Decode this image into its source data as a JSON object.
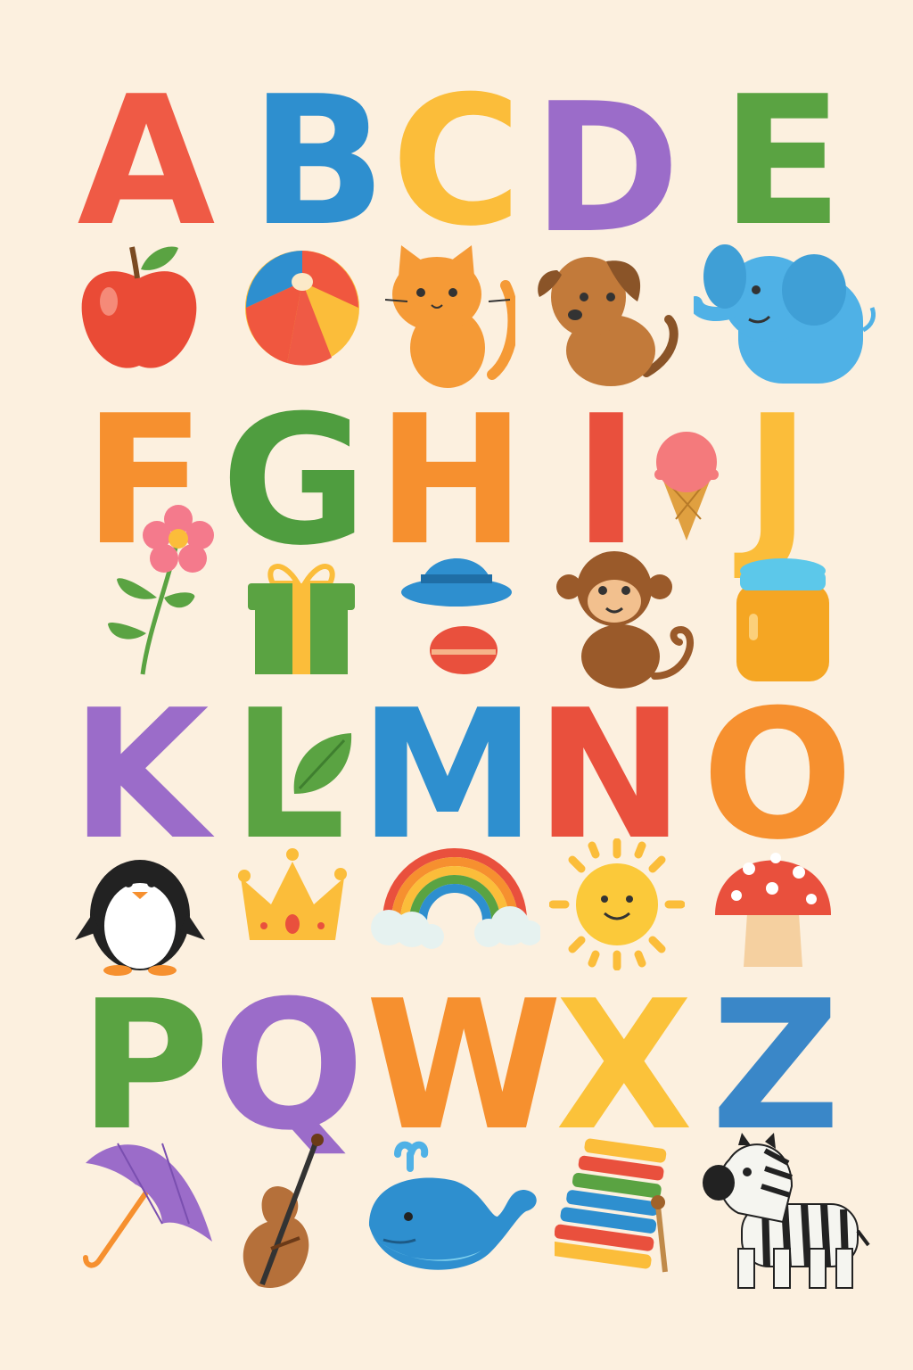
{
  "rows": [
    {
      "letters": [
        {
          "char": "A",
          "color": "#ef5a45"
        },
        {
          "char": "B",
          "color": "#2e8fcf"
        },
        {
          "char": "C",
          "color": "#fbbd3a"
        },
        {
          "char": "D",
          "color": "#9b6cc9"
        },
        {
          "char": "E",
          "color": "#5aa342"
        }
      ],
      "icons": [
        "apple-icon",
        "beach-ball-icon",
        "cat-icon",
        "dog-icon",
        "elephant-icon"
      ]
    },
    {
      "letters": [
        {
          "char": "F",
          "color": "#f6902f"
        },
        {
          "char": "G",
          "color": "#4f9d3f"
        },
        {
          "char": "H",
          "color": "#f6902f"
        },
        {
          "char": "I",
          "color": "#e9503d"
        },
        {
          "char": "J",
          "color": "#fbbd3a"
        }
      ],
      "icons": [
        "flower-icon",
        "gift-icon",
        "hat-icon",
        "ice-cream-icon",
        "monkey-icon",
        "jar-icon"
      ]
    },
    {
      "letters": [
        {
          "char": "K",
          "color": "#9b6cc9"
        },
        {
          "char": "L",
          "color": "#5aa342"
        },
        {
          "char": "M",
          "color": "#2e8fcf"
        },
        {
          "char": "N",
          "color": "#e9503d"
        },
        {
          "char": "O",
          "color": "#f6902f"
        }
      ],
      "icons": [
        "penguin-icon",
        "crown-icon",
        "rainbow-icon",
        "sun-icon",
        "mushroom-icon"
      ]
    },
    {
      "letters": [
        {
          "char": "P",
          "color": "#5aa342"
        },
        {
          "char": "Q",
          "color": "#9b6cc9"
        },
        {
          "char": "W",
          "color": "#f6902f"
        },
        {
          "char": "X",
          "color": "#fbc23a"
        },
        {
          "char": "Z",
          "color": "#3a87c8"
        }
      ],
      "icons": [
        "umbrella-icon",
        "violin-icon",
        "whale-icon",
        "xylophone-icon",
        "zebra-icon"
      ]
    }
  ],
  "background": "#fcf0df"
}
